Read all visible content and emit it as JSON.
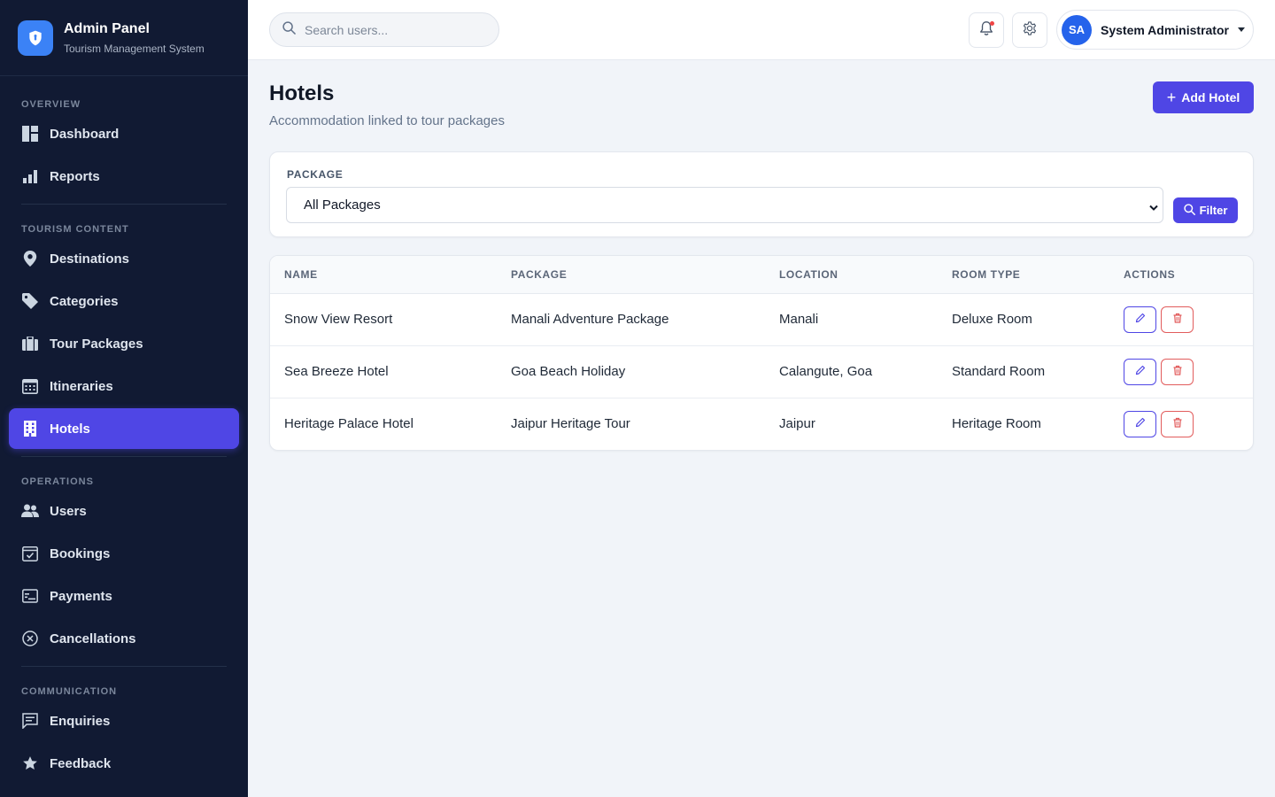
{
  "brand": {
    "title": "Admin Panel",
    "subtitle": "Tourism Management System"
  },
  "sidebar": {
    "sections": [
      {
        "label": "OVERVIEW",
        "items": [
          {
            "label": "Dashboard",
            "icon": "dashboard-icon"
          },
          {
            "label": "Reports",
            "icon": "bar-chart-icon"
          }
        ]
      },
      {
        "label": "TOURISM CONTENT",
        "items": [
          {
            "label": "Destinations",
            "icon": "location-pin-icon"
          },
          {
            "label": "Categories",
            "icon": "tag-icon"
          },
          {
            "label": "Tour Packages",
            "icon": "briefcase-icon"
          },
          {
            "label": "Itineraries",
            "icon": "calendar-grid-icon"
          },
          {
            "label": "Hotels",
            "icon": "building-icon",
            "active": true
          }
        ]
      },
      {
        "label": "OPERATIONS",
        "items": [
          {
            "label": "Users",
            "icon": "users-icon"
          },
          {
            "label": "Bookings",
            "icon": "calendar-check-icon"
          },
          {
            "label": "Payments",
            "icon": "card-icon"
          },
          {
            "label": "Cancellations",
            "icon": "cancel-circle-icon"
          }
        ]
      },
      {
        "label": "COMMUNICATION",
        "items": [
          {
            "label": "Enquiries",
            "icon": "message-icon"
          },
          {
            "label": "Feedback",
            "icon": "star-icon"
          }
        ]
      }
    ]
  },
  "topbar": {
    "search_placeholder": "Search users...",
    "user": {
      "initials": "SA",
      "name": "System Administrator"
    }
  },
  "page": {
    "title": "Hotels",
    "subtitle": "Accommodation linked to tour packages",
    "add_button": "Add Hotel"
  },
  "filter": {
    "label": "PACKAGE",
    "selected": "All Packages",
    "button": "Filter"
  },
  "table": {
    "headers": [
      "NAME",
      "PACKAGE",
      "LOCATION",
      "ROOM TYPE",
      "ACTIONS"
    ],
    "rows": [
      {
        "name": "Snow View Resort",
        "package": "Manali Adventure Package",
        "location": "Manali",
        "room_type": "Deluxe Room"
      },
      {
        "name": "Sea Breeze Hotel",
        "package": "Goa Beach Holiday",
        "location": "Calangute, Goa",
        "room_type": "Standard Room"
      },
      {
        "name": "Heritage Palace Hotel",
        "package": "Jaipur Heritage Tour",
        "location": "Jaipur",
        "room_type": "Heritage Room"
      }
    ]
  },
  "colors": {
    "accent": "#4f46e5",
    "sidebar_bg": "#111a33",
    "danger": "#e25c5c",
    "avatar": "#2563eb"
  }
}
